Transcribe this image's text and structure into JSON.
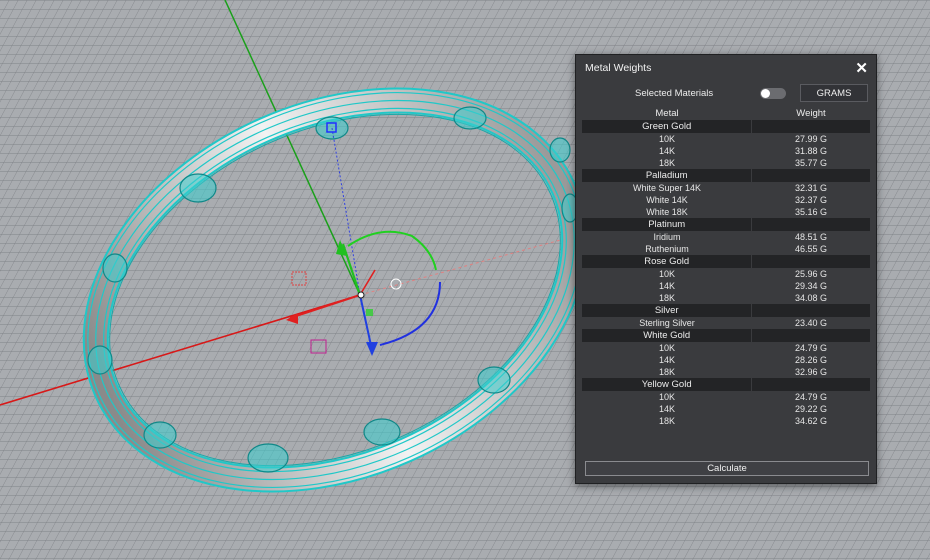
{
  "panel": {
    "title": "Metal Weights",
    "close_symbol": "✕",
    "selected_materials_label": "Selected Materials",
    "selected_materials_on": false,
    "units_label": "GRAMS",
    "col_metal": "Metal",
    "col_weight": "Weight",
    "groups": [
      {
        "name": "Green Gold",
        "items": [
          {
            "name": "10K",
            "weight": "27.99 G"
          },
          {
            "name": "14K",
            "weight": "31.88 G"
          },
          {
            "name": "18K",
            "weight": "35.77 G"
          }
        ]
      },
      {
        "name": "Palladium",
        "items": [
          {
            "name": "White Super 14K",
            "weight": "32.31 G"
          },
          {
            "name": "White 14K",
            "weight": "32.37 G"
          },
          {
            "name": "White 18K",
            "weight": "35.16 G"
          }
        ]
      },
      {
        "name": "Platinum",
        "items": [
          {
            "name": "Iridium",
            "weight": "48.51 G"
          },
          {
            "name": "Ruthenium",
            "weight": "46.55 G"
          }
        ]
      },
      {
        "name": "Rose Gold",
        "items": [
          {
            "name": "10K",
            "weight": "25.96 G"
          },
          {
            "name": "14K",
            "weight": "29.34 G"
          },
          {
            "name": "18K",
            "weight": "34.08 G"
          }
        ]
      },
      {
        "name": "Silver",
        "items": [
          {
            "name": "Sterling Silver",
            "weight": "23.40 G"
          }
        ]
      },
      {
        "name": "White Gold",
        "items": [
          {
            "name": "10K",
            "weight": "24.79 G"
          },
          {
            "name": "14K",
            "weight": "28.26 G"
          },
          {
            "name": "18K",
            "weight": "32.96 G"
          }
        ]
      },
      {
        "name": "Yellow Gold",
        "items": [
          {
            "name": "10K",
            "weight": "24.79 G"
          },
          {
            "name": "14K",
            "weight": "29.22 G"
          },
          {
            "name": "18K",
            "weight": "34.62 G"
          }
        ]
      }
    ],
    "calculate_label": "Calculate"
  },
  "colors": {
    "panel_bg": "#3a3b3e",
    "group_row_bg": "#232426",
    "ring_highlight": "#20c8c8",
    "axis_x": "#e02020",
    "axis_y": "#20b020",
    "axis_z": "#2030e0"
  }
}
